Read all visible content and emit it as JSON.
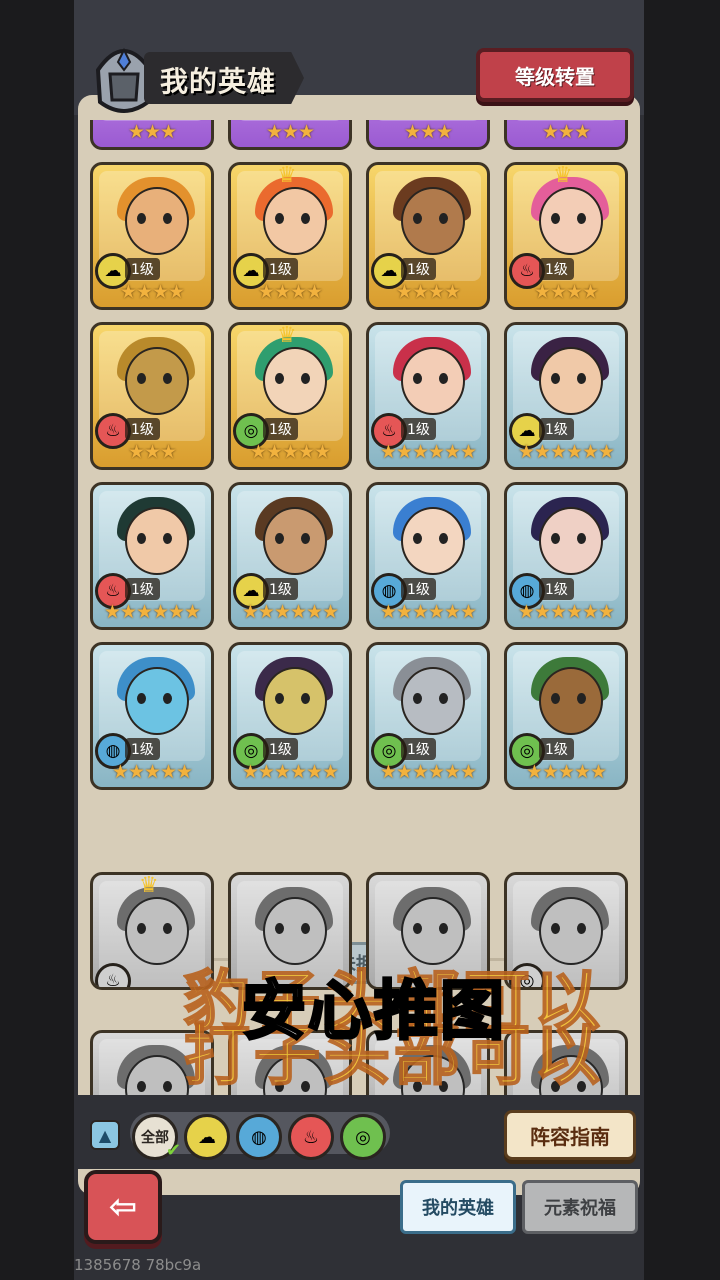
{
  "header": {
    "title": "我的英雄",
    "reset_label": "等级转置"
  },
  "owned_heroes": [
    {
      "level": "1级",
      "stars": "★★★★",
      "frame": "gold",
      "elem": "☁",
      "elem_color": "#e6d24a",
      "hair": "#e3912d",
      "skin": "#e8b07a",
      "crown": false
    },
    {
      "level": "1级",
      "stars": "★★★★",
      "frame": "gold",
      "elem": "☁",
      "elem_color": "#e6d24a",
      "hair": "#ea6a2e",
      "skin": "#f2c8a4",
      "crown": true
    },
    {
      "level": "1级",
      "stars": "★★★★",
      "frame": "gold",
      "elem": "☁",
      "elem_color": "#e6d24a",
      "hair": "#6b3b1f",
      "skin": "#b07a4c",
      "crown": false
    },
    {
      "level": "1级",
      "stars": "★★★★",
      "frame": "gold",
      "elem": "♨",
      "elem_color": "#e55656",
      "hair": "#e45e9a",
      "skin": "#f3cdb6",
      "crown": true
    },
    {
      "level": "1级",
      "stars": "★★★",
      "frame": "gold",
      "elem": "♨",
      "elem_color": "#e55656",
      "hair": "#b98a2b",
      "skin": "#c39a4a",
      "crown": false
    },
    {
      "level": "1级",
      "stars": "★★★★★",
      "frame": "gold",
      "elem": "◎",
      "elem_color": "#6fc04f",
      "hair": "#2f9e6f",
      "skin": "#f2d4b8",
      "crown": true
    },
    {
      "level": "1级",
      "stars": "★★★★★★",
      "frame": "blue",
      "elem": "♨",
      "elem_color": "#e55656",
      "hair": "#c9304a",
      "skin": "#f3cdb6",
      "crown": false
    },
    {
      "level": "1级",
      "stars": "★★★★★★",
      "frame": "blue",
      "elem": "☁",
      "elem_color": "#e6d24a",
      "hair": "#3a2244",
      "skin": "#f0c9a8",
      "crown": false
    },
    {
      "level": "1级",
      "stars": "★★★★★★",
      "frame": "blue",
      "elem": "♨",
      "elem_color": "#e55656",
      "hair": "#1f3a34",
      "skin": "#f0c9a8",
      "crown": false
    },
    {
      "level": "1级",
      "stars": "★★★★★★",
      "frame": "blue",
      "elem": "☁",
      "elem_color": "#e6d24a",
      "hair": "#5a3a22",
      "skin": "#c99a70",
      "crown": false
    },
    {
      "level": "1级",
      "stars": "★★★★★★",
      "frame": "blue",
      "elem": "◍",
      "elem_color": "#57a9d8",
      "hair": "#3a7fd1",
      "skin": "#f3d6c0",
      "crown": false
    },
    {
      "level": "1级",
      "stars": "★★★★★★",
      "frame": "blue",
      "elem": "◍",
      "elem_color": "#57a9d8",
      "hair": "#2b2450",
      "skin": "#efd0c5",
      "crown": false
    },
    {
      "level": "1级",
      "stars": "★★★★★",
      "frame": "blue",
      "elem": "◍",
      "elem_color": "#57a9d8",
      "hair": "#3e8fc9",
      "skin": "#6cc3e3",
      "crown": false
    },
    {
      "level": "1级",
      "stars": "★★★★★★",
      "frame": "blue",
      "elem": "◎",
      "elem_color": "#6fc04f",
      "hair": "#3b2a4a",
      "skin": "#d6c26a",
      "crown": false
    },
    {
      "level": "1级",
      "stars": "★★★★★★",
      "frame": "blue",
      "elem": "◎",
      "elem_color": "#6fc04f",
      "hair": "#8a8f96",
      "skin": "#b7bcc2",
      "crown": false
    },
    {
      "level": "1级",
      "stars": "★★★★★",
      "frame": "blue",
      "elem": "◎",
      "elem_color": "#6fc04f",
      "hair": "#3d7a3a",
      "skin": "#9a6a3a",
      "crown": false
    }
  ],
  "partial_top_stars": [
    "★★★",
    "★★★",
    "★★★",
    "★★★"
  ],
  "not_owned_label": "未拥有",
  "not_owned_heroes": [
    {
      "elem": "♨",
      "crown": true
    },
    {
      "elem": "",
      "crown": false
    },
    {
      "elem": "",
      "crown": false
    },
    {
      "elem": "◎",
      "crown": false
    }
  ],
  "overlay": {
    "main": "安心推图"
  },
  "filters": {
    "all_label": "全部",
    "items": [
      {
        "name": "wind",
        "glyph": "☁",
        "color": "#e6d24a"
      },
      {
        "name": "water",
        "glyph": "◍",
        "color": "#57a9d8"
      },
      {
        "name": "fire",
        "glyph": "♨",
        "color": "#e55656"
      },
      {
        "name": "nature",
        "glyph": "◎",
        "color": "#6fc04f"
      }
    ]
  },
  "guide_label": "阵容指南",
  "tabs": {
    "my_heroes": "我的英雄",
    "element_blessing": "元素祝福"
  },
  "build_id": "1385678 78bc9a"
}
